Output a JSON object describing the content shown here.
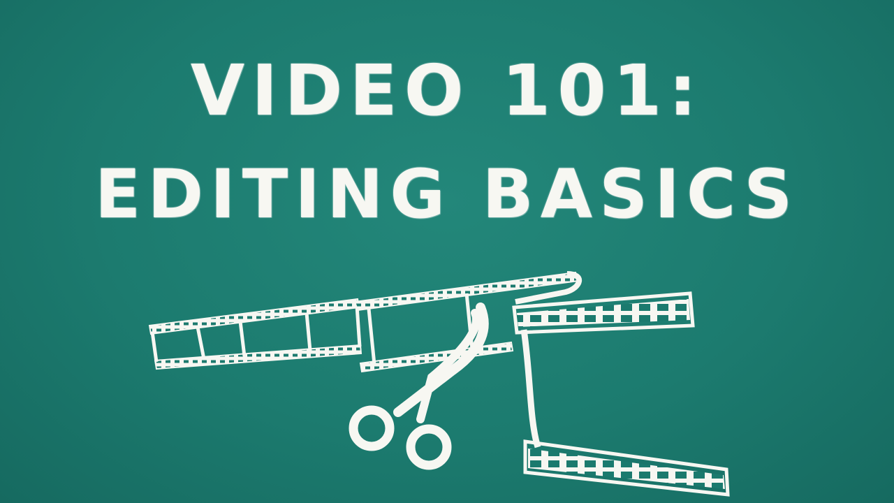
{
  "title": {
    "line1": "VIDEO 101:",
    "line2": "EDITING BASICS"
  },
  "illustration": {
    "icons": [
      "film-strip-icon",
      "scissors-icon"
    ],
    "chalk_color": "#f7f7f2",
    "board_color": "#1b7a6e"
  }
}
